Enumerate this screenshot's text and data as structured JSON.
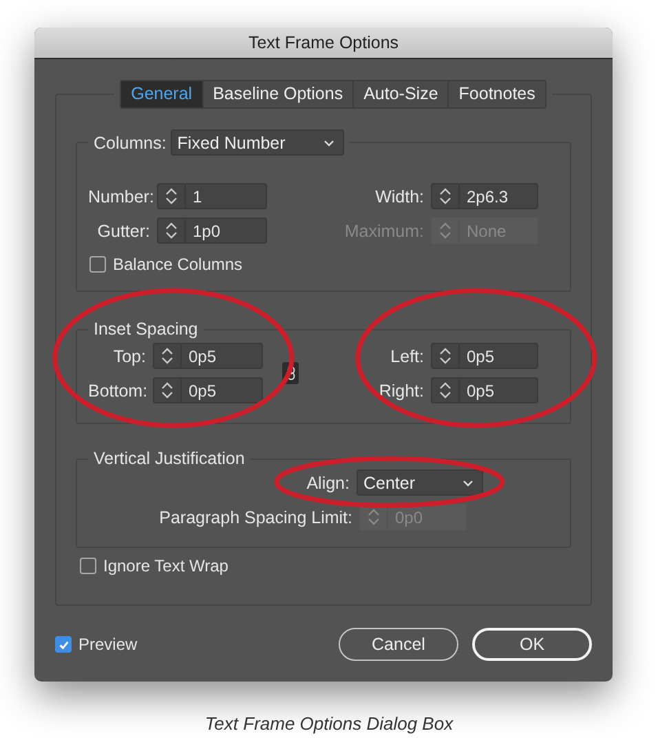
{
  "window": {
    "title": "Text Frame Options"
  },
  "tabs": [
    {
      "label": "General",
      "selected": true
    },
    {
      "label": "Baseline Options",
      "selected": false
    },
    {
      "label": "Auto-Size",
      "selected": false
    },
    {
      "label": "Footnotes",
      "selected": false
    }
  ],
  "columns": {
    "label": "Columns:",
    "mode": "Fixed Number",
    "fields": [
      {
        "label": "Number:",
        "value": "1",
        "disabled": false
      },
      {
        "label": "Width:",
        "value": "2p6.3",
        "disabled": false
      },
      {
        "label": "Gutter:",
        "value": "1p0",
        "disabled": false
      },
      {
        "label": "Maximum:",
        "value": "None",
        "disabled": true
      }
    ],
    "balance": {
      "label": "Balance Columns",
      "checked": false
    }
  },
  "inset_spacing": {
    "title": "Inset Spacing",
    "fields": [
      {
        "label": "Top:",
        "value": "0p5",
        "disabled": false
      },
      {
        "label": "Left:",
        "value": "0p5",
        "disabled": false
      },
      {
        "label": "Bottom:",
        "value": "0p5",
        "disabled": false
      },
      {
        "label": "Right:",
        "value": "0p5",
        "disabled": false
      }
    ]
  },
  "vertical_justification": {
    "title": "Vertical Justification",
    "align": {
      "label": "Align:",
      "value": "Center"
    },
    "paragraph_spacing_limit": {
      "label": "Paragraph Spacing Limit:",
      "value": "0p0",
      "disabled": true
    }
  },
  "ignore_text_wrap": {
    "label": "Ignore Text Wrap",
    "checked": false
  },
  "preview": {
    "label": "Preview",
    "checked": true
  },
  "buttons": [
    {
      "label": "Cancel",
      "default": false
    },
    {
      "label": "OK",
      "default": true
    }
  ],
  "caption": "Text Frame Options Dialog Box"
}
